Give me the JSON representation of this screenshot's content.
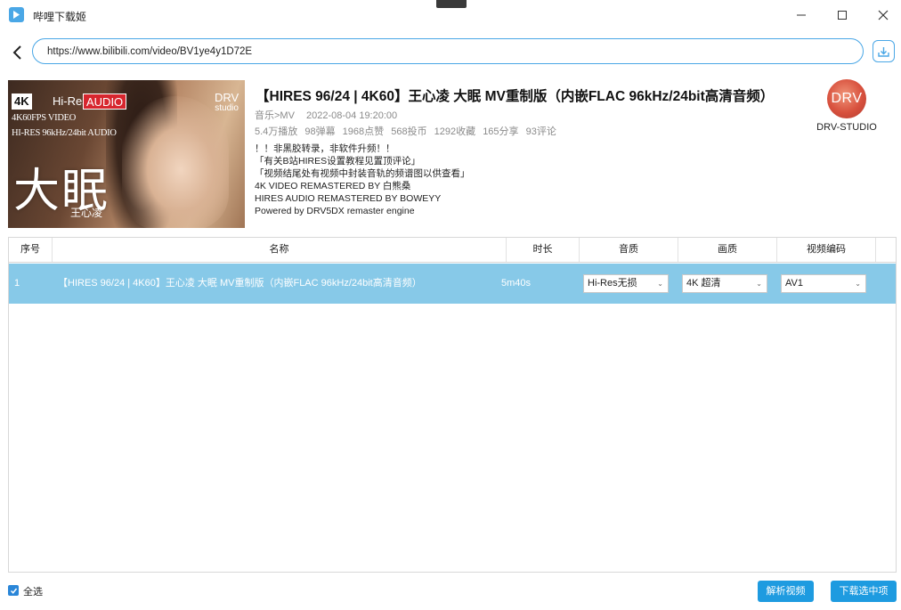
{
  "app": {
    "title": "哔哩下载姬"
  },
  "address": {
    "url": "https://www.bilibili.com/video/BV1ye4y1D72E"
  },
  "thumbnail": {
    "badge_4k": "4K",
    "badge_hires": "Hi-Res",
    "badge_audio": "AUDIO",
    "line1": "4K60FPS VIDEO",
    "line2": "HI-RES 96kHz/24bit AUDIO",
    "drv_top": "DRV",
    "drv_bottom": "studio",
    "big_text": "大眠",
    "artist": "王心凌"
  },
  "video": {
    "title": "【HIRES 96/24 | 4K60】王心凌 大眠 MV重制版（内嵌FLAC 96kHz/24bit高清音频）",
    "category": "音乐>MV",
    "date": "2022-08-04 19:20:00",
    "stats": [
      "5.4万播放",
      "98弹幕",
      "1968点赞",
      "568投币",
      "1292收藏",
      "165分享",
      "93评论"
    ],
    "description": [
      "！！非黑胶转录，非软件升频！！",
      "「有关B站HIRES设置教程见置顶评论」",
      "「视频结尾处有视频中封装音轨的频谱图以供查看」",
      "4K VIDEO REMASTERED BY 白熊桑",
      "HIRES AUDIO REMASTERED BY BOWEYY",
      "Powered by DRV5DX remaster engine"
    ]
  },
  "uploader": {
    "avatar_text": "DRV",
    "name": "DRV-STUDIO"
  },
  "table": {
    "headers": {
      "no": "序号",
      "name": "名称",
      "duration": "时长",
      "audio_quality": "音质",
      "video_quality": "画质",
      "codec": "视频编码"
    },
    "rows": [
      {
        "no": "1",
        "name": "【HIRES 96/24 | 4K60】王心凌 大眠 MV重制版（内嵌FLAC 96kHz/24bit高清音频）",
        "duration": "5m40s",
        "audio_quality": "Hi-Res无损",
        "video_quality": "4K 超清",
        "codec": "AV1"
      }
    ]
  },
  "footer": {
    "select_all": "全选",
    "parse_button": "解析视频",
    "download_button": "下载选中项"
  },
  "colors": {
    "accent": "#1e9be0",
    "selected_row": "#87c9e8",
    "url_border": "#4aa7e6"
  }
}
